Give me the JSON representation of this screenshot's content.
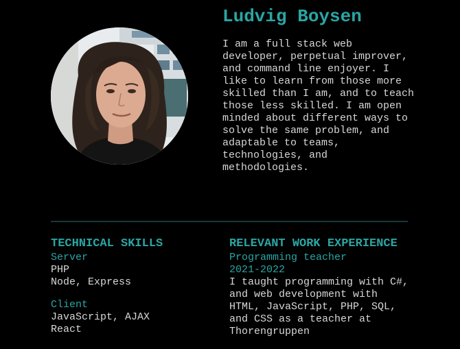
{
  "profile": {
    "name": "Ludvig Boysen",
    "bio": "I am a full stack web developer, perpetual improver, and command line enjoyer. I like to learn from those more skilled than I am, and to teach those less skilled. I am open minded about different ways to solve the same problem, and adaptable to teams, technologies, and methodologies."
  },
  "skills": {
    "heading": "TECHNICAL SKILLS",
    "groups": [
      {
        "title": "Server",
        "items": [
          "PHP",
          "Node, Express"
        ]
      },
      {
        "title": "Client",
        "items": [
          "JavaScript, AJAX",
          "React"
        ]
      }
    ]
  },
  "experience": {
    "heading": "RELEVANT WORK EXPERIENCE",
    "jobs": [
      {
        "title": "Programming teacher",
        "period": "2021-2022",
        "description": "I taught programming with C#, and web development with HTML, JavaScript, PHP, SQL, and CSS as a teacher at Thorengruppen"
      }
    ]
  },
  "colors": {
    "background": "#000000",
    "accent": "#2aa6a4",
    "text": "#d8d8d8",
    "divider": "#17383b"
  }
}
